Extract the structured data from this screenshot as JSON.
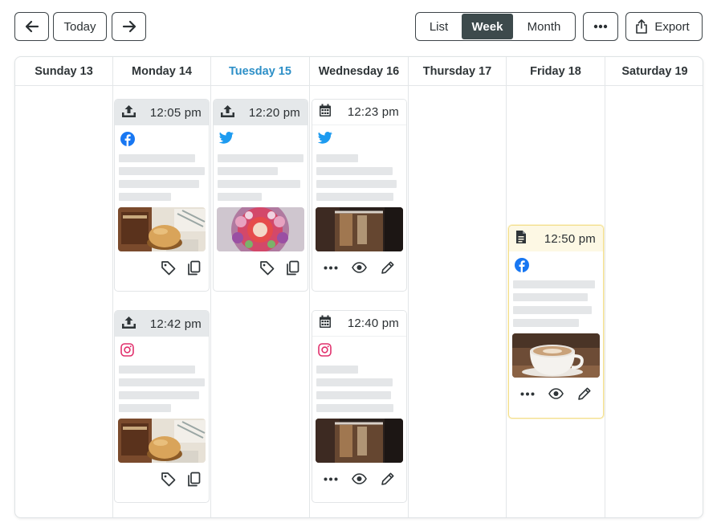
{
  "toolbar": {
    "prev_icon": "arrow-left-icon",
    "today_label": "Today",
    "next_icon": "arrow-right-icon",
    "views": [
      "List",
      "Week",
      "Month"
    ],
    "active_view": "Week",
    "more_icon": "ellipsis-icon",
    "export_label": "Export",
    "export_icon": "share-upload-icon"
  },
  "days": [
    {
      "label": "Sunday 13",
      "is_today": false
    },
    {
      "label": "Monday 14",
      "is_today": false
    },
    {
      "label": "Tuesday 15",
      "is_today": true
    },
    {
      "label": "Wednesday 16",
      "is_today": false
    },
    {
      "label": "Thursday 17",
      "is_today": false
    },
    {
      "label": "Friday 18",
      "is_today": false
    },
    {
      "label": "Saturday 19",
      "is_today": false
    }
  ],
  "posts": [
    {
      "day": "Monday 14",
      "time": "12:05 pm",
      "status": "published",
      "status_icon": "upload-tray-icon",
      "network": "facebook",
      "network_icon": "facebook-icon",
      "image": "burger-photo",
      "actions": [
        "tag-icon",
        "copy-icon"
      ]
    },
    {
      "day": "Monday 14",
      "time": "12:42 pm",
      "status": "published",
      "status_icon": "upload-tray-icon",
      "network": "instagram",
      "network_icon": "instagram-icon",
      "image": "burger-photo",
      "actions": [
        "tag-icon",
        "copy-icon"
      ]
    },
    {
      "day": "Tuesday 15",
      "time": "12:20 pm",
      "status": "published",
      "status_icon": "upload-tray-icon",
      "network": "twitter",
      "network_icon": "twitter-icon",
      "image": "flower-platter-photo",
      "actions": [
        "tag-icon",
        "copy-icon"
      ]
    },
    {
      "day": "Wednesday 16",
      "time": "12:23 pm",
      "status": "scheduled",
      "status_icon": "calendar-icon",
      "network": "twitter",
      "network_icon": "twitter-icon",
      "image": "iced-coffee-photo",
      "actions": [
        "ellipsis-icon",
        "eye-icon",
        "pencil-icon"
      ]
    },
    {
      "day": "Wednesday 16",
      "time": "12:40 pm",
      "status": "scheduled",
      "status_icon": "calendar-icon",
      "network": "instagram",
      "network_icon": "instagram-icon",
      "image": "iced-coffee-photo",
      "actions": [
        "ellipsis-icon",
        "eye-icon",
        "pencil-icon"
      ]
    },
    {
      "day": "Friday 18",
      "time": "12:50 pm",
      "status": "draft",
      "status_icon": "document-icon",
      "network": "facebook",
      "network_icon": "facebook-icon",
      "image": "latte-cup-photo",
      "actions": [
        "ellipsis-icon",
        "eye-icon",
        "pencil-icon"
      ]
    }
  ],
  "colors": {
    "accent_today": "#2d8fc7",
    "active_view_bg": "#3d4a4c",
    "published_header": "#e5e8ea",
    "draft_border": "#f3df8f",
    "facebook": "#1877f2",
    "twitter": "#1d9bf0",
    "instagram": "#e1306c",
    "placeholder_text": "#e4e6e8"
  }
}
